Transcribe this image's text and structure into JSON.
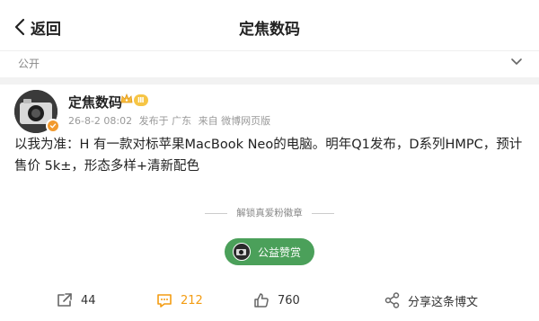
{
  "header": {
    "back_label": "返回",
    "title": "定焦数码"
  },
  "visibility": {
    "label": "公开"
  },
  "post": {
    "username": "定焦数码",
    "level_badge": "Ⅲ",
    "meta": {
      "time": "26-8-2 08:02",
      "location": "发布于 广东",
      "source": "来自 微博网页版"
    },
    "text": "以我为准：H 有一款对标苹果MacBook Neo的电脑。明年Q1发布，D系列HMPC，预计售价 5k±，形态多样+清新配色"
  },
  "fan_badge": {
    "label": "解锁真爱粉徽章"
  },
  "reward": {
    "label": "公益赞赏"
  },
  "actions": {
    "share_count": "44",
    "comment_count": "212",
    "like_count": "760",
    "share_text": "分享这条博文"
  },
  "colors": {
    "accent_orange": "#f39c12",
    "reward_green": "#4ba05a",
    "level_gold": "#f6c545"
  },
  "icons": {
    "back": "chevron-left-icon",
    "visibility_toggle": "chevron-down-icon",
    "repost": "repost-icon",
    "comment": "comment-icon",
    "like": "thumbs-up-icon",
    "share": "share-nodes-icon"
  }
}
